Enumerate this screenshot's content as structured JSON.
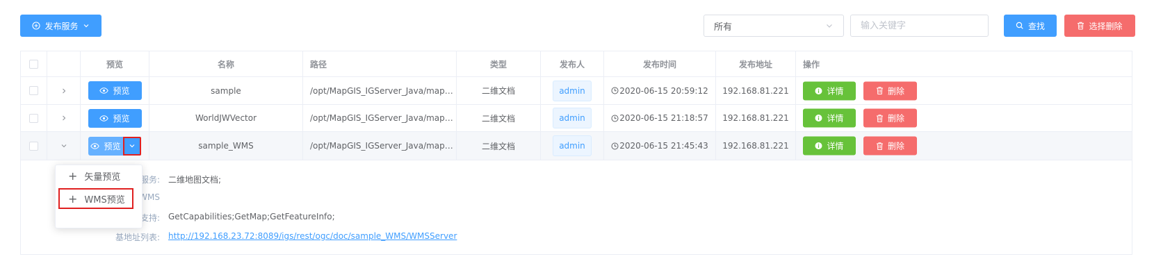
{
  "toolbar": {
    "publish_label": "发布服务",
    "filter_value": "所有",
    "keyword_placeholder": "输入关键字",
    "search_label": "查找",
    "delete_selected_label": "选择删除"
  },
  "columns": [
    "预览",
    "名称",
    "路径",
    "类型",
    "发布人",
    "发布时间",
    "发布地址",
    "操作"
  ],
  "rows": [
    {
      "preview": "预览",
      "name": "sample",
      "path": "/opt/MapGIS_IGServer_Java/map…",
      "type": "二维文档",
      "publisher": "admin",
      "time": "2020-06-15 20:59:12",
      "address": "192.168.81.221",
      "detail": "详情",
      "delete": "删除"
    },
    {
      "preview": "预览",
      "name": "WorldJWVector",
      "path": "/opt/MapGIS_IGServer_Java/map…",
      "type": "二维文档",
      "publisher": "admin",
      "time": "2020-06-15 21:18:57",
      "address": "192.168.81.221",
      "detail": "详情",
      "delete": "删除"
    },
    {
      "preview": "预览",
      "name": "sample_WMS",
      "path": "/opt/MapGIS_IGServer_Java/map…",
      "type": "二维文档",
      "publisher": "admin",
      "time": "2020-06-15 21:45:43",
      "address": "192.168.81.221",
      "detail": "详情",
      "delete": "删除"
    }
  ],
  "expanded": {
    "service_label": "服务:",
    "service_value": "二维地图文档;",
    "ogc_label": "WMS",
    "support_label": "支持:",
    "support_value": "GetCapabilities;GetMap;GetFeatureInfo;",
    "base_url_label": "基地址列表:",
    "base_url_value": "http://192.168.23.72:8089/igs/rest/ogc/doc/sample_WMS/WMSServer"
  },
  "dropdown": {
    "items": [
      "矢量预览",
      "WMS预览"
    ]
  },
  "colors": {
    "primary": "#409eff",
    "success": "#67c23a",
    "danger": "#f56c6c",
    "highlight": "#e02020"
  }
}
